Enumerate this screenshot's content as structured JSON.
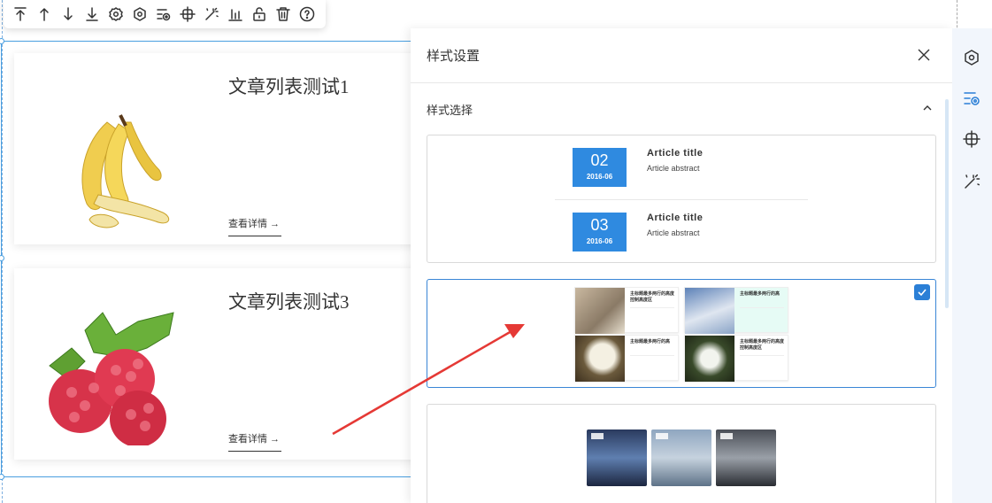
{
  "toolbar": {
    "icons": [
      "move-top-icon",
      "move-up-icon",
      "move-down-icon",
      "move-bottom-icon",
      "settings-icon",
      "style-icon",
      "animation-icon",
      "position-icon",
      "magic-wand-icon",
      "align-icon",
      "unlock-icon",
      "delete-icon",
      "help-icon"
    ]
  },
  "articles": [
    {
      "title": "文章列表测试1",
      "more": "查看详情 →",
      "image": "banana"
    },
    {
      "title": "文章列表测试3",
      "more": "查看详情 →",
      "image": "raspberry"
    }
  ],
  "panel": {
    "title": "样式设置",
    "section": "样式选择",
    "style1": {
      "items": [
        {
          "day": "02",
          "ym": "2016-06",
          "title": "Article  title",
          "abstract": "Article abstract"
        },
        {
          "day": "03",
          "ym": "2016-06",
          "title": "Article  title",
          "abstract": "Article abstract"
        }
      ]
    },
    "style2": {
      "selected": true,
      "items": [
        {
          "title": "主标题最多两行的高度控制高度区"
        },
        {
          "title": "主标题最多两行的高"
        },
        {
          "title": "主标题最多两行的高"
        },
        {
          "title": "主标题最多两行的高度控制高度区"
        }
      ]
    }
  },
  "sidebar": {
    "icons": [
      "style-icon",
      "animation-icon",
      "position-icon",
      "magic-wand-icon"
    ],
    "active": 1
  },
  "colors": {
    "accent": "#2b7fd6",
    "date_bg": "#2f8ae0",
    "arrow": "#e53935"
  }
}
